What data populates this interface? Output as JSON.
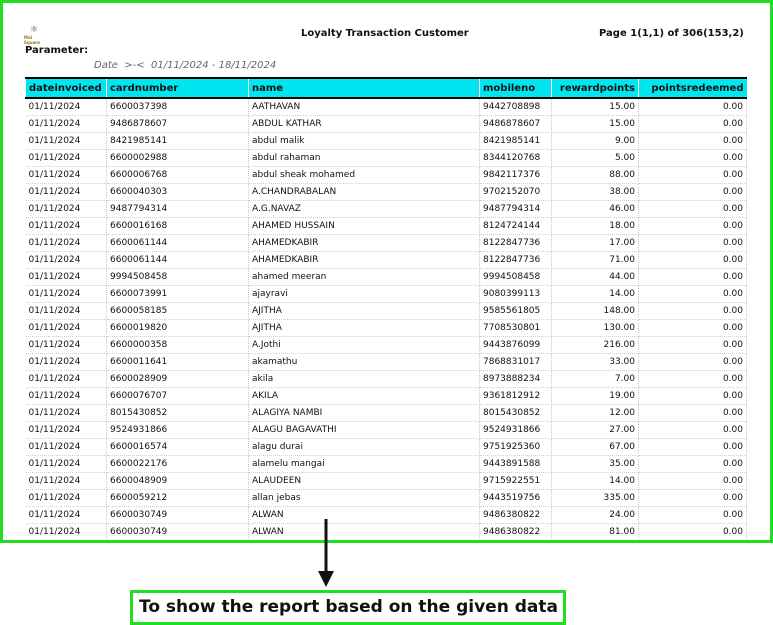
{
  "report": {
    "title": "Loyalty Transaction Customer",
    "page_info": "Page 1(1,1) of 306(153,2)",
    "parameter_label": "Parameter:",
    "parameter_value": "Date  >-<  01/11/2024 - 18/11/2024",
    "logo_text": "Mal Square"
  },
  "table": {
    "columns": [
      "dateinvoiced",
      "cardnumber",
      "name",
      "mobileno",
      "rewardpoints",
      "pointsredeemed"
    ],
    "rows": [
      [
        "01/11/2024",
        "6600037398",
        "AATHAVAN",
        "9442708898",
        "15.00",
        "0.00"
      ],
      [
        "01/11/2024",
        "9486878607",
        "ABDUL KATHAR",
        "9486878607",
        "15.00",
        "0.00"
      ],
      [
        "01/11/2024",
        "8421985141",
        "abdul malik",
        "8421985141",
        "9.00",
        "0.00"
      ],
      [
        "01/11/2024",
        "6600002988",
        "abdul rahaman",
        "8344120768",
        "5.00",
        "0.00"
      ],
      [
        "01/11/2024",
        "6600006768",
        "abdul sheak mohamed",
        "9842117376",
        "88.00",
        "0.00"
      ],
      [
        "01/11/2024",
        "6600040303",
        "A.CHANDRABALAN",
        "9702152070",
        "38.00",
        "0.00"
      ],
      [
        "01/11/2024",
        "9487794314",
        "A.G.NAVAZ",
        "9487794314",
        "46.00",
        "0.00"
      ],
      [
        "01/11/2024",
        "6600016168",
        "AHAMED HUSSAIN",
        "8124724144",
        "18.00",
        "0.00"
      ],
      [
        "01/11/2024",
        "6600061144",
        "AHAMEDKABIR",
        "8122847736",
        "17.00",
        "0.00"
      ],
      [
        "01/11/2024",
        "6600061144",
        "AHAMEDKABIR",
        "8122847736",
        "71.00",
        "0.00"
      ],
      [
        "01/11/2024",
        "9994508458",
        "ahamed meeran",
        "9994508458",
        "44.00",
        "0.00"
      ],
      [
        "01/11/2024",
        "6600073991",
        "ajayravi",
        "9080399113",
        "14.00",
        "0.00"
      ],
      [
        "01/11/2024",
        "6600058185",
        "AJITHA",
        "9585561805",
        "148.00",
        "0.00"
      ],
      [
        "01/11/2024",
        "6600019820",
        "AJITHA",
        "7708530801",
        "130.00",
        "0.00"
      ],
      [
        "01/11/2024",
        "6600000358",
        "A.Jothi",
        "9443876099",
        "216.00",
        "0.00"
      ],
      [
        "01/11/2024",
        "6600011641",
        "akamathu",
        "7868831017",
        "33.00",
        "0.00"
      ],
      [
        "01/11/2024",
        "6600028909",
        "akila",
        "8973888234",
        "7.00",
        "0.00"
      ],
      [
        "01/11/2024",
        "6600076707",
        "AKILA",
        "9361812912",
        "19.00",
        "0.00"
      ],
      [
        "01/11/2024",
        "8015430852",
        "ALAGIYA NAMBI",
        "8015430852",
        "12.00",
        "0.00"
      ],
      [
        "01/11/2024",
        "9524931866",
        "ALAGU BAGAVATHI",
        "9524931866",
        "27.00",
        "0.00"
      ],
      [
        "01/11/2024",
        "6600016574",
        "alagu durai",
        "9751925360",
        "67.00",
        "0.00"
      ],
      [
        "01/11/2024",
        "6600022176",
        "alamelu mangai",
        "9443891588",
        "35.00",
        "0.00"
      ],
      [
        "01/11/2024",
        "6600048909",
        "ALAUDEEN",
        "9715922551",
        "14.00",
        "0.00"
      ],
      [
        "01/11/2024",
        "6600059212",
        "allan jebas",
        "9443519756",
        "335.00",
        "0.00"
      ],
      [
        "01/11/2024",
        "6600030749",
        "ALWAN",
        "9486380822",
        "24.00",
        "0.00"
      ],
      [
        "01/11/2024",
        "6600030749",
        "ALWAN",
        "9486380822",
        "81.00",
        "0.00"
      ]
    ]
  },
  "annotation": {
    "caption": "To show the report based on the given data",
    "accent_color": "#22dd22",
    "header_color": "#00e5f0"
  }
}
